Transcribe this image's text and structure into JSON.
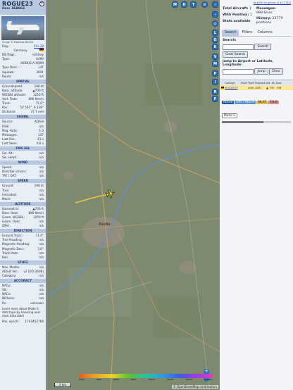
{
  "left": {
    "callsign": "ROGUE23",
    "hex_label": "Hex:",
    "hex": "3EA063",
    "photo_credit": "Image © Matthias Becker",
    "rows": [
      {
        "k": "Reg.:",
        "v": "54+38",
        "link": true
      },
      {
        "k": "",
        "v": "Germany",
        "flag": true
      },
      {
        "k": "DB flags:",
        "v": "military"
      },
      {
        "k": "Type:",
        "v": "A400"
      },
      {
        "k": "",
        "v": "AIRBUS A-400M",
        "center": true
      },
      {
        "k": "Type Desc.:",
        "v": "L4T"
      },
      {
        "k": "Squawk:",
        "v": "3601"
      },
      {
        "k": "Route:",
        "v": "n/a"
      }
    ],
    "spatial_title": "SPATIAL",
    "spatial": [
      {
        "k": "Groundspeed:",
        "v": "198 kt"
      },
      {
        "k": "Baro. altitude:",
        "v": "▲700 ft"
      },
      {
        "k": "WGS84 altitude:",
        "v": "1250 ft"
      },
      {
        "k": "Vert. Rate:",
        "v": "896 ft/min"
      },
      {
        "k": "Track:",
        "v": "71.0°"
      },
      {
        "k": "Pos.:",
        "v": "52.561°, 6.118°"
      },
      {
        "k": "Distance:",
        "v": "37.7 nmi"
      }
    ],
    "signal_title": "SIGNAL",
    "signal": [
      {
        "k": "Source:",
        "v": "ADS-B"
      },
      {
        "k": "RSSI:",
        "v": "n/a"
      },
      {
        "k": "Msg. Rate:",
        "v": "1.0"
      },
      {
        "k": "Messages:",
        "v": "147"
      },
      {
        "k": "Last Pos.:",
        "v": "43 s"
      },
      {
        "k": "Last Seen:",
        "v": "0.6 s"
      }
    ],
    "fms_title": "FMS SEL",
    "fms": [
      {
        "k": "Sel. Alt.:",
        "v": "n/a"
      },
      {
        "k": "Sel. Head.:",
        "v": "n/a"
      }
    ],
    "wind_title": "WIND",
    "wind": [
      {
        "k": "Speed:",
        "v": "n/a"
      },
      {
        "k": "Direction (from):",
        "v": "n/a"
      },
      {
        "k": "TAT / OAT:",
        "v": "n/a"
      }
    ],
    "speed_title": "SPEED",
    "speed": [
      {
        "k": "Ground:",
        "v": "198 kt"
      },
      {
        "k": "True:",
        "v": "n/a"
      },
      {
        "k": "Indicated:",
        "v": "n/a"
      },
      {
        "k": "Mach:",
        "v": "n/a"
      }
    ],
    "altitude_title": "ALTITUDE",
    "altitude": [
      {
        "k": "Barometric:",
        "v": "▲700 ft"
      },
      {
        "k": "Baro. Rate:",
        "v": "896 ft/min"
      },
      {
        "k": "Geom. WGS84:",
        "v": "1250 ft"
      },
      {
        "k": "Geom. Rate:",
        "v": "n/a"
      },
      {
        "k": "QNH:",
        "v": "n/a"
      }
    ],
    "direction_title": "DIRECTION",
    "direction": [
      {
        "k": "Ground Track:",
        "v": "71.0°"
      },
      {
        "k": "True Heading:",
        "v": "n/a"
      },
      {
        "k": "Magnetic Heading:",
        "v": "n/a"
      },
      {
        "k": "Magnetic Decl.:",
        "v": "3.0°"
      },
      {
        "k": "Track Rate:",
        "v": "n/a"
      },
      {
        "k": "Roll:",
        "v": "n/a"
      }
    ],
    "stuff_title": "STUFF",
    "stuff": [
      {
        "k": "Nav. Modes:",
        "v": "n/a"
      },
      {
        "k": "ADS-B Ver.:",
        "v": "v2 (DO-260B)"
      },
      {
        "k": "Category:",
        "v": "n/a"
      }
    ],
    "accuracy_title": "ACCURACY",
    "accuracy": [
      {
        "k": "NACp:",
        "v": "n/a"
      },
      {
        "k": "SIL:",
        "v": "n/a"
      },
      {
        "k": "NACv:",
        "v": "n/a"
      },
      {
        "k": "NICbaro:",
        "v": "n/a"
      },
      {
        "k": "Rc:",
        "v": "unknown"
      }
    ],
    "learn_more": "Learn more about Mode S data type by hovering over each data label",
    "pos_epoch_label": "Pos. epoch:",
    "pos_epoch": "1743452794"
  },
  "map": {
    "top_buttons": [
      "M",
      "H",
      "T"
    ],
    "side_buttons": [
      "L",
      "O",
      "K",
      "V",
      "M",
      "P",
      "I",
      "R",
      "F"
    ],
    "scale_label": "2 km",
    "alt_ticks": [
      "2000",
      "4000",
      "6000",
      "8000",
      "10000",
      "20000",
      "30000",
      "40000+"
    ],
    "osm_credit": "© OpenStreetMap contributors",
    "city_label": "Zwolle",
    "colors": {
      "track": "#e8c43a",
      "aircraft": "#e8d22b",
      "water": "#6a8fb5",
      "road": "#c99d6b"
    }
  },
  "right": {
    "top_link": "tar1090 on github (3.14.1702)",
    "total_aircraft_label": "Total Aircraft:",
    "total_aircraft": "1",
    "with_position_label": "With Position:",
    "with_position": "1",
    "stats_label": "Stats available",
    "messages_label": "Messages:",
    "messages": "989.6/sec",
    "history_label": "History:",
    "history": "23779 positions",
    "tabs": [
      "Search",
      "Filters",
      "Columns"
    ],
    "search_label": "Search:",
    "search_button": "Search",
    "clear_search_button": "Clear Search",
    "jump_label": "Jump to Airport or Latitude, Longitude:",
    "jump_button": "Jump",
    "clear_button": "Clear",
    "columns": [
      "",
      "Callsign",
      "Route",
      "Type",
      "Squawk",
      "Alt. (ft)",
      "Spd."
    ],
    "rows": [
      {
        "flag": "",
        "callsign": "ROGUE23",
        "route": "",
        "type": "A400",
        "squawk": "3601",
        "alt": "▲ 700",
        "spd": "198"
      }
    ],
    "sources": [
      "ADS-B",
      "UAT / ADS-R",
      "MLAT",
      "TIS-B",
      "Mode-S"
    ]
  }
}
